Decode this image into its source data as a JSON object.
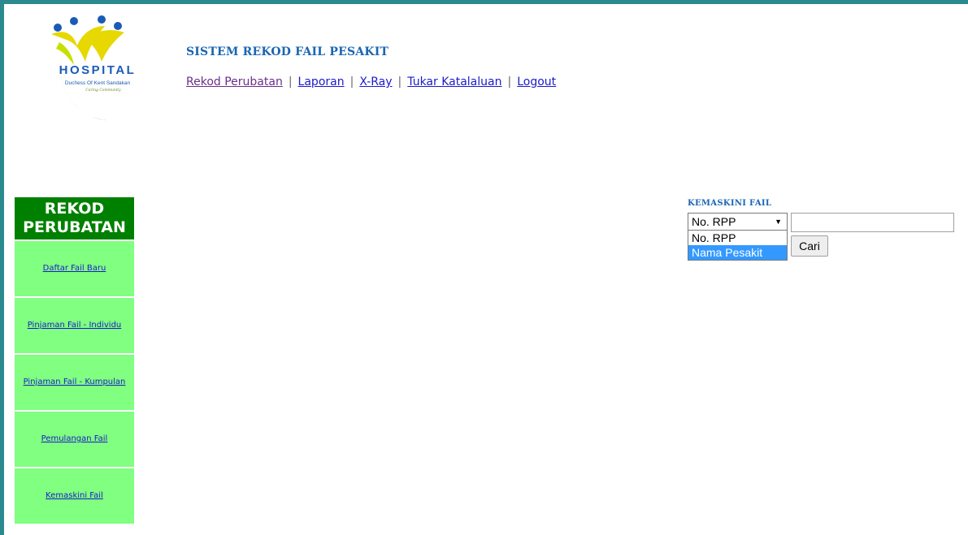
{
  "logo": {
    "word": "HOSPITAL",
    "subtitle": "Duchess Of Kent Sandakan",
    "tagline": "Caring Community"
  },
  "header": {
    "title": "SISTEM REKOD FAIL PESAKIT",
    "nav": [
      {
        "label": "Rekod Perubatan"
      },
      {
        "label": "Laporan"
      },
      {
        "label": "X-Ray"
      },
      {
        "label": "Tukar Katalaluan"
      },
      {
        "label": "Logout"
      }
    ],
    "separator": "|"
  },
  "sidebar": {
    "heading": "REKOD PERUBATAN",
    "items": [
      {
        "label": "Daftar Fail Baru"
      },
      {
        "label": "Pinjaman Fail - Individu"
      },
      {
        "label": "Pinjaman Fail - Kumpulan"
      },
      {
        "label": "Pemulangan Fail"
      },
      {
        "label": "Kemaskini Fail"
      }
    ]
  },
  "update_panel": {
    "title": "KEMASKINI FAIL",
    "select_value": "No. RPP",
    "options": [
      "No. RPP",
      "Nama Pesakit"
    ],
    "highlighted_option": "Nama Pesakit",
    "search_value": "",
    "button_label": "Cari"
  },
  "colors": {
    "frame": "#2a8a8f",
    "sidebar_heading": "#008000",
    "sidebar_item": "#80ff80",
    "title_blue": "#1a66b3",
    "option_highlight": "#3399ff"
  }
}
